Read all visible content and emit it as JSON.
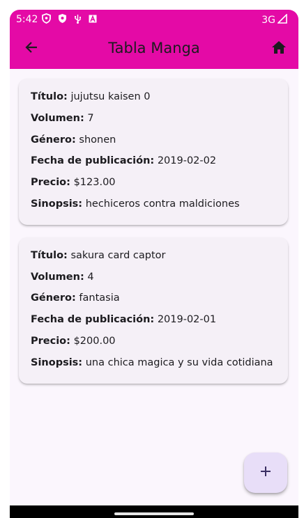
{
  "status_bar": {
    "time": "5:42",
    "network": "3G",
    "icons_left": [
      "shield-outline-icon",
      "shield-filled-icon",
      "usb-icon",
      "font-a-icon"
    ],
    "signal_icon": "signal-icon"
  },
  "app_bar": {
    "title": "Tabla Manga",
    "back_icon": "arrow-back-icon",
    "home_icon": "home-icon",
    "color": "#e40aa6"
  },
  "labels": {
    "titulo": "Título:",
    "volumen": "Volumen:",
    "genero": "Género:",
    "fecha": "Fecha de publicación:",
    "precio": "Precio:",
    "sinopsis": "Sinopsis:"
  },
  "mangas": [
    {
      "titulo": "jujutsu kaisen 0",
      "volumen": "7",
      "genero": "shonen",
      "fecha": "2019-02-02",
      "precio": "$123.00",
      "sinopsis": "hechiceros contra maldiciones"
    },
    {
      "titulo": "sakura card captor",
      "volumen": "4",
      "genero": "fantasia",
      "fecha": "2019-02-01",
      "precio": "$200.00",
      "sinopsis": "una chica magica y su vida cotidiana"
    }
  ],
  "fab": {
    "icon": "add-icon",
    "color": "#e8def8"
  }
}
